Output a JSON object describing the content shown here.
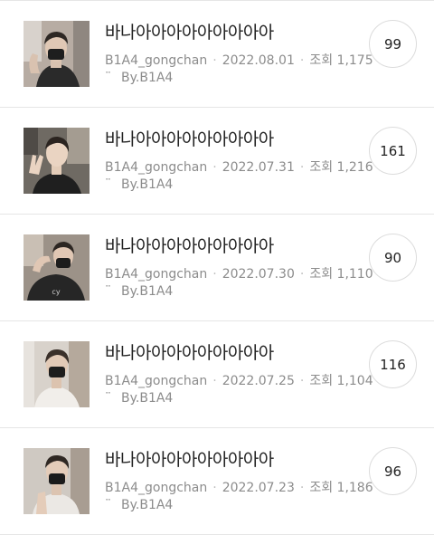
{
  "posts": [
    {
      "title": "바나아아아아아아아아아",
      "author": "B1A4_gongchan",
      "date": "2022.08.01",
      "views_label": "조회",
      "views": "1,175",
      "byline_emoticon": "¨",
      "byline": "By.B1A4",
      "comments": "99"
    },
    {
      "title": "바나아아아아아아아아아",
      "author": "B1A4_gongchan",
      "date": "2022.07.31",
      "views_label": "조회",
      "views": "1,216",
      "byline_emoticon": "¨",
      "byline": "By.B1A4",
      "comments": "161"
    },
    {
      "title": "바나아아아아아아아아아",
      "author": "B1A4_gongchan",
      "date": "2022.07.30",
      "views_label": "조회",
      "views": "1,110",
      "byline_emoticon": "¨",
      "byline": "By.B1A4",
      "comments": "90"
    },
    {
      "title": "바나아아아아아아아아아",
      "author": "B1A4_gongchan",
      "date": "2022.07.25",
      "views_label": "조회",
      "views": "1,104",
      "byline_emoticon": "¨",
      "byline": "By.B1A4",
      "comments": "116"
    },
    {
      "title": "바나아아아아아아아아아",
      "author": "B1A4_gongchan",
      "date": "2022.07.23",
      "views_label": "조회",
      "views": "1,186",
      "byline_emoticon": "¨",
      "byline": "By.B1A4",
      "comments": "96"
    }
  ],
  "separator": "·",
  "colors": {
    "title": "#222222",
    "meta": "#8c8c8c",
    "divider": "#e6e6e6",
    "circle_border": "#dcdcdc"
  }
}
